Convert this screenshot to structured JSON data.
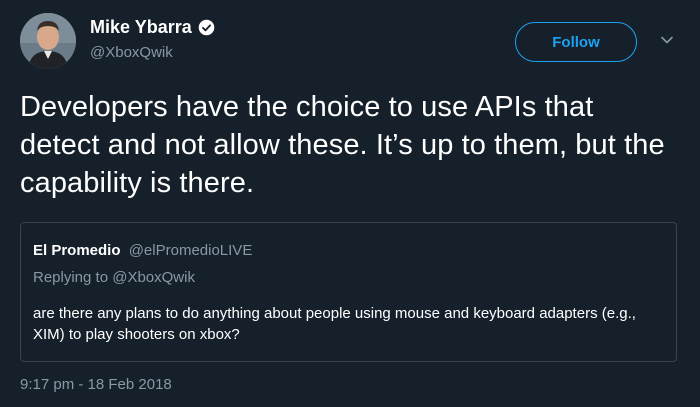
{
  "author": {
    "name": "Mike Ybarra",
    "handle": "@XboxQwik",
    "verified": true
  },
  "actions": {
    "follow_label": "Follow",
    "menu_icon": "chevron-down-icon"
  },
  "tweet": {
    "text": "Developers have the choice to use APIs that detect and not allow these. It’s up to them, but the capability is there.",
    "timestamp": "9:17 pm - 18 Feb 2018"
  },
  "quoted": {
    "name": "El Promedio",
    "handle": "@elPromedioLIVE",
    "replying_prefix": "Replying to",
    "replying_to": "@XboxQwik",
    "text": "are there any plans to do anything about people using mouse and keyboard adapters (e.g., XIM) to play shooters on xbox?"
  },
  "colors": {
    "background": "#15202b",
    "accent": "#1da1f2",
    "secondary_text": "#8899a6",
    "border": "#38444d"
  }
}
